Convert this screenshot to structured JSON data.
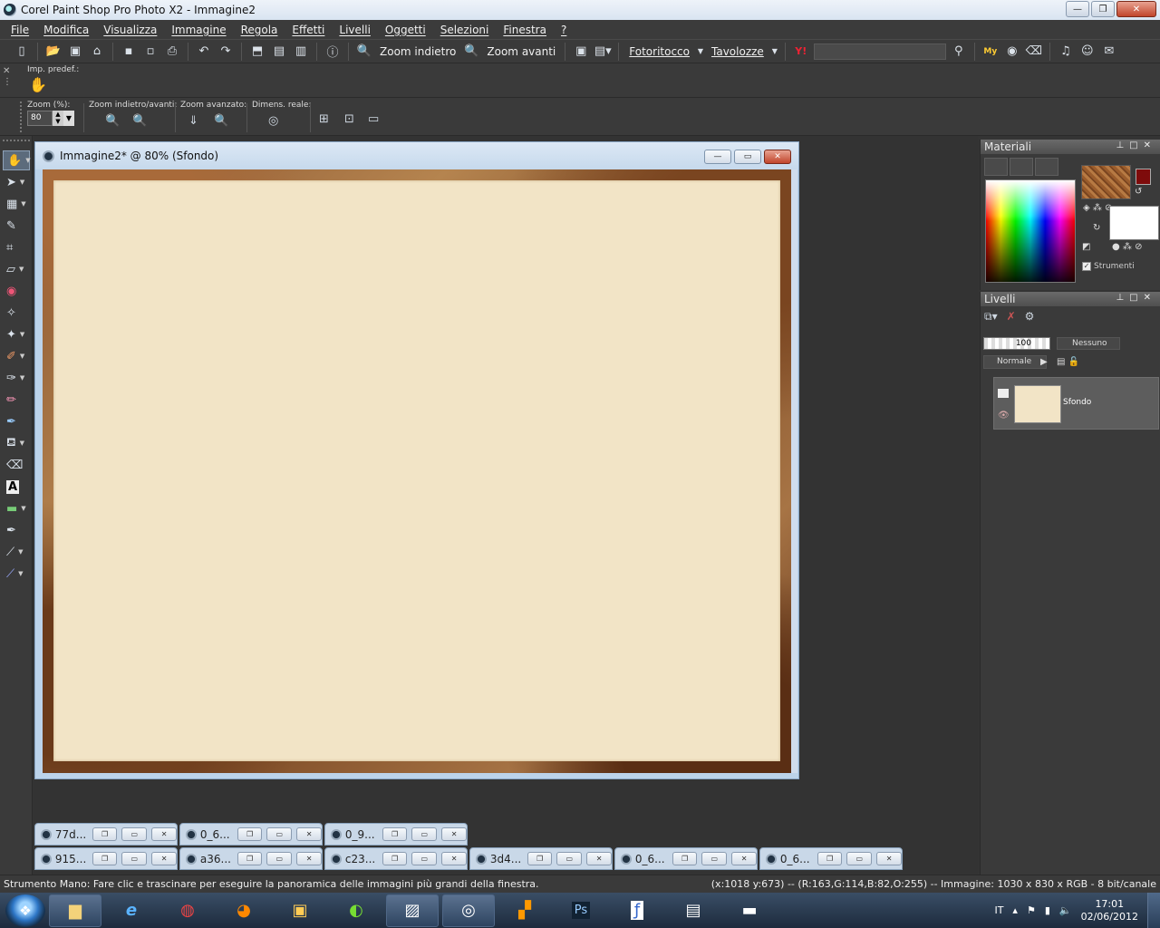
{
  "window": {
    "title": "Corel Paint Shop Pro Photo X2 - Immagine2",
    "min": "—",
    "max": "❐",
    "close": "✕"
  },
  "menu": [
    "File",
    "Modifica",
    "Visualizza",
    "Immagine",
    "Regola",
    "Effetti",
    "Livelli",
    "Oggetti",
    "Selezioni",
    "Finestra",
    "?"
  ],
  "toolbar": {
    "zoom_out": "Zoom indietro",
    "zoom_in": "Zoom avanti",
    "photo_retouch": "Fotoritocco",
    "palettes": "Tavolozze",
    "search_placeholder": ""
  },
  "presets": {
    "label": "Imp. predef.:",
    "hand_icon": "✋"
  },
  "tool_options": {
    "zoom_label": "Zoom (%):",
    "zoom_value": "80",
    "zoom_inout_label": "Zoom indietro/avanti:",
    "zoom_adv_label": "Zoom avanzato:",
    "actual_size_label": "Dimens. reale:"
  },
  "document": {
    "title": "Immagine2* @  80% (Sfondo)",
    "paper_color": "#f2e4c6",
    "frame_color": "#8a5530"
  },
  "minimized": [
    {
      "name": "77d..."
    },
    {
      "name": "0_6..."
    },
    {
      "name": "0_9..."
    },
    {
      "name": "915..."
    },
    {
      "name": "a36..."
    },
    {
      "name": "c23..."
    },
    {
      "name": "3d4..."
    },
    {
      "name": "0_6..."
    },
    {
      "name": "0_6..."
    }
  ],
  "materials": {
    "title": "Materiali",
    "strumenti": "Strumenti",
    "foreground": "#7e0b0b",
    "background": "#ffffff"
  },
  "layers": {
    "title": "Livelli",
    "opacity": "100",
    "mask": "Nessuno",
    "blend": "Normale",
    "layer_name": "Sfondo"
  },
  "status": {
    "message": "Strumento Mano: Fare clic e trascinare per eseguire la panoramica delle immagini più grandi della finestra.",
    "info": "(x:1018 y:673) -- (R:163,G:114,B:82,O:255) -- Immagine:  1030 x 830 x RGB - 8 bit/canale"
  },
  "taskbar": {
    "lang": "IT",
    "time": "17:01",
    "date": "02/06/2012"
  }
}
